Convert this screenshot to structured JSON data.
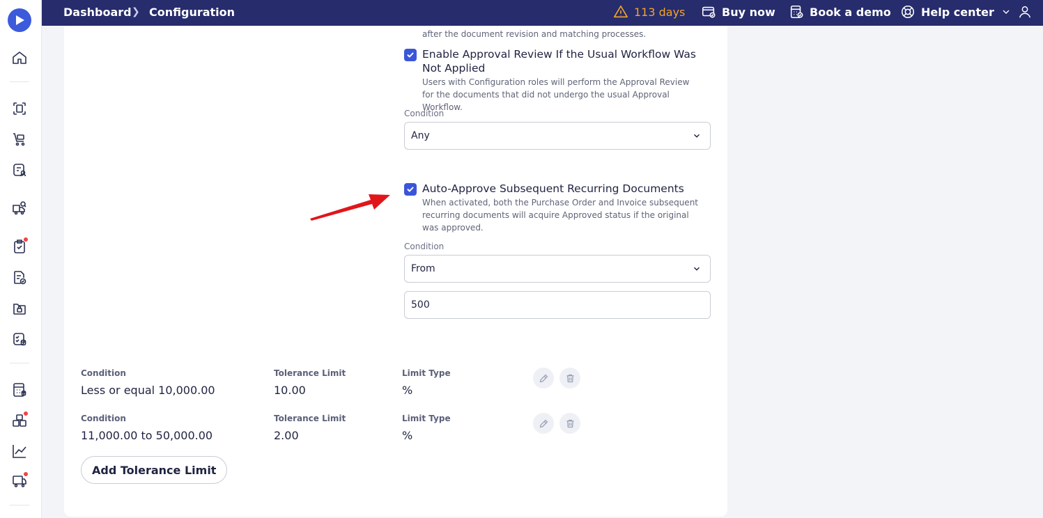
{
  "breadcrumb": {
    "dashboard": "Dashboard",
    "current": "Configuration"
  },
  "topbar": {
    "trial": "113 days",
    "buy_now": "Buy now",
    "book_demo": "Book a demo",
    "help_center": "Help center"
  },
  "partial_text": "after the document revision and matching processes.",
  "approval_review": {
    "checked": true,
    "title": "Enable Approval Review If the Usual Workflow Was Not Applied",
    "description": "Users with Configuration roles will perform the Approval Review for the documents that did not undergo the usual Approval Workflow.",
    "condition_label": "Condition",
    "condition_value": "Any"
  },
  "auto_approve": {
    "checked": true,
    "title": "Auto-Approve Subsequent Recurring Documents",
    "description": "When activated, both the Purchase Order and Invoice subsequent recurring documents will acquire Approved status if the original was approved.",
    "condition_label": "Condition",
    "condition_value": "From",
    "amount": "500"
  },
  "tolerance_limits": {
    "headers": {
      "condition": "Condition",
      "tolerance": "Tolerance Limit",
      "type": "Limit Type"
    },
    "rows": [
      {
        "condition": "Less or equal 10,000.00",
        "tolerance": "10.00",
        "type": "%"
      },
      {
        "condition": "11,000.00 to 50,000.00",
        "tolerance": "2.00",
        "type": "%"
      }
    ],
    "add_button": "Add Tolerance Limit"
  },
  "colors": {
    "topbar": "#262c6c",
    "accent": "#3b55d9",
    "warning": "#f5a524",
    "notification": "#ef4444",
    "arrow": "#e0161b"
  },
  "icons": {
    "sidebar": [
      "home-icon",
      "scan-document-icon",
      "cart-icon",
      "document-user-icon",
      "truck-search-icon",
      "clipboard-check-icon",
      "document-check-icon",
      "folder-lock-icon",
      "checklist-db-icon",
      "calculator-icon",
      "boxes-icon",
      "chart-line-icon",
      "delivery-truck-icon"
    ],
    "topbar": [
      "warning-icon",
      "wallet-icon",
      "calendar-icon",
      "lifebuoy-icon",
      "chevron-down-icon",
      "user-icon"
    ]
  }
}
